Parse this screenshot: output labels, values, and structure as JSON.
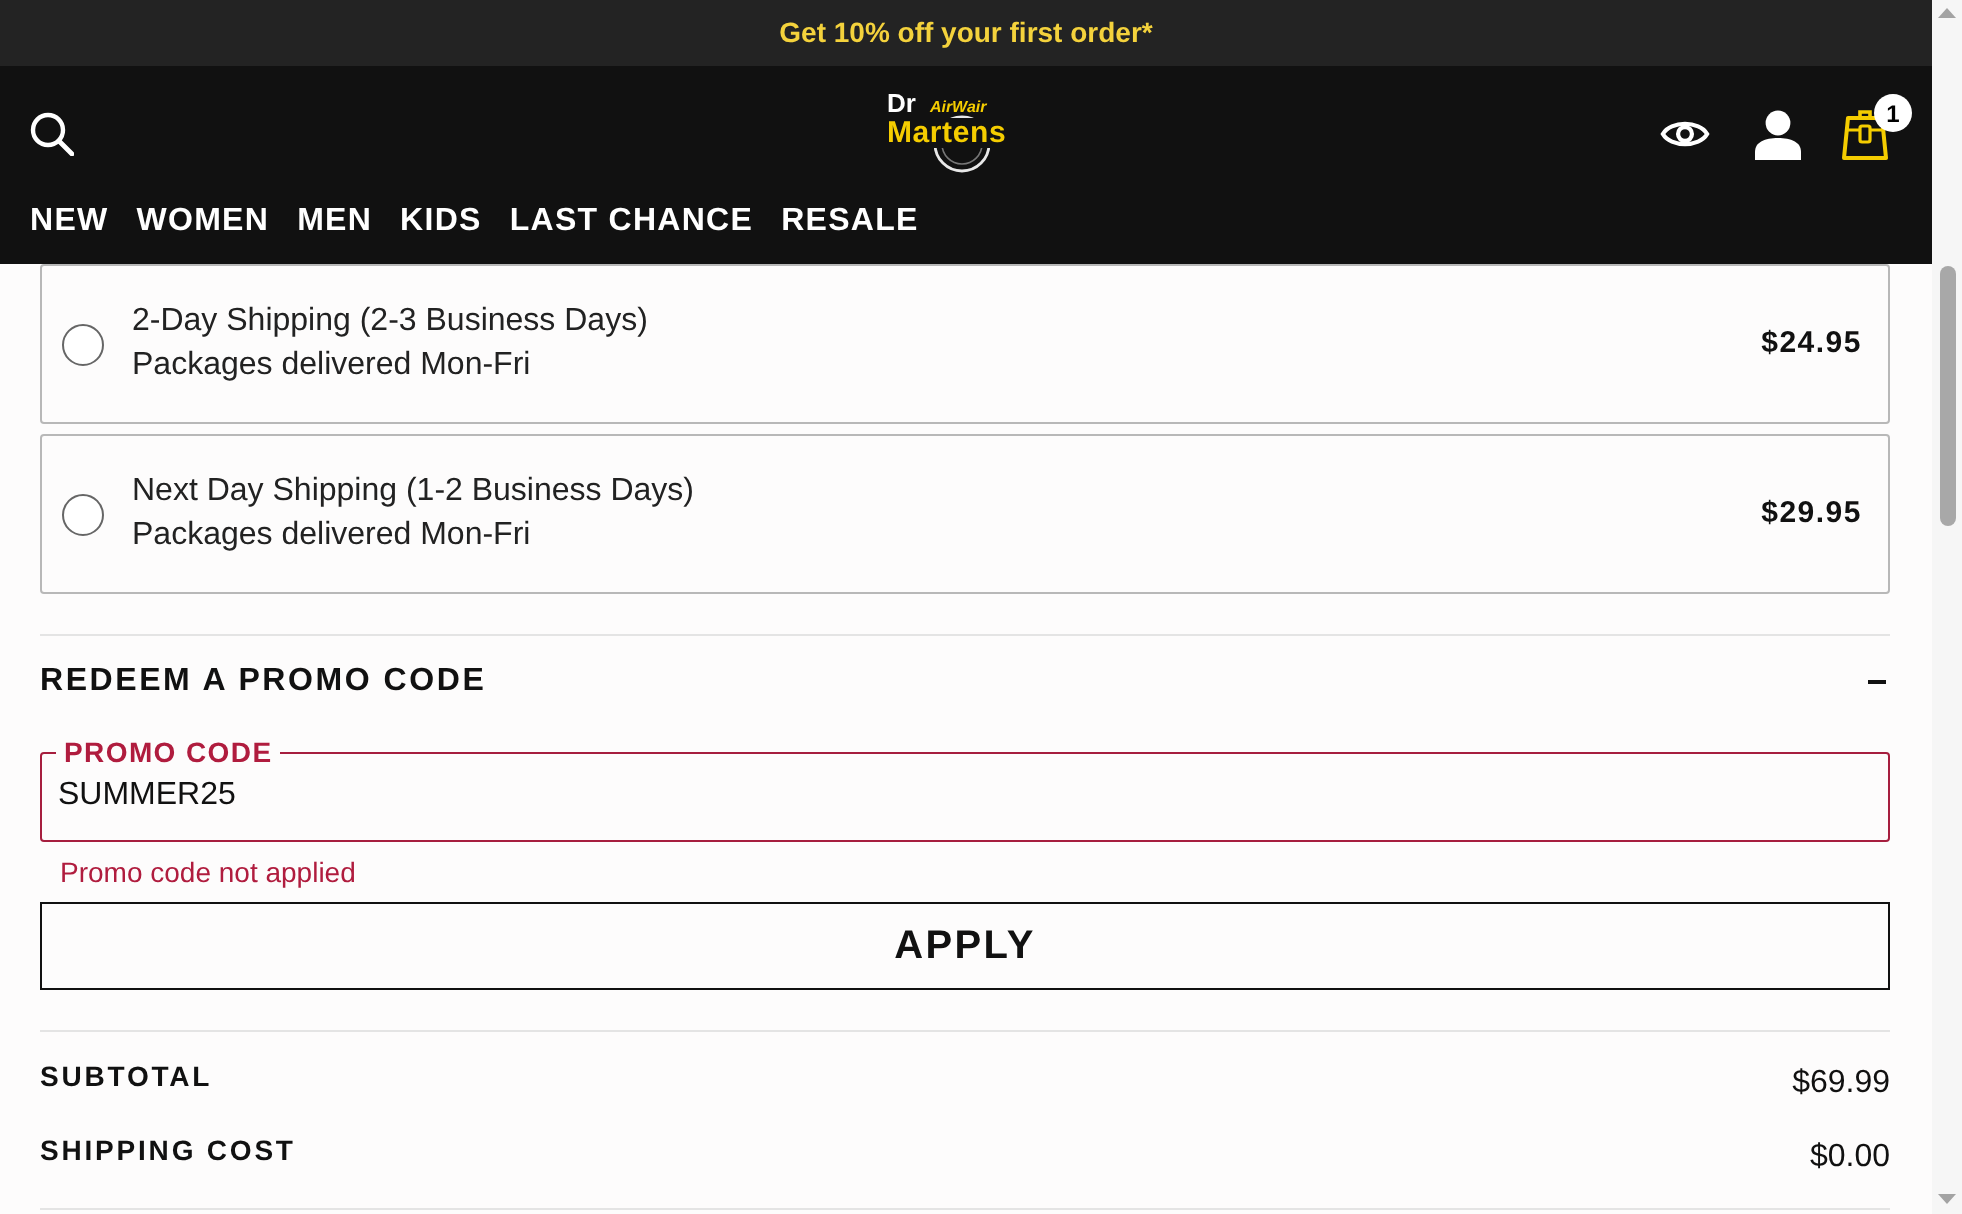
{
  "banner": {
    "text": "Get 10% off your first order*"
  },
  "header": {
    "logo": {
      "line_1": "Dr",
      "tag": "AirWair",
      "line_2": "Martens"
    },
    "cart_count": "1"
  },
  "nav": [
    {
      "label": "NEW"
    },
    {
      "label": "WOMEN"
    },
    {
      "label": "MEN"
    },
    {
      "label": "KIDS"
    },
    {
      "label": "LAST CHANCE"
    },
    {
      "label": "RESALE"
    }
  ],
  "shipping_options": [
    {
      "name": "2-Day Shipping (2-3 Business Days)",
      "detail": "Packages delivered Mon-Fri",
      "price": "$24.95",
      "selected": false
    },
    {
      "name": "Next Day Shipping (1-2 Business Days)",
      "detail": "Packages delivered Mon-Fri",
      "price": "$29.95",
      "selected": false
    }
  ],
  "promo": {
    "title": "REDEEM A PROMO CODE",
    "expanded": true,
    "field": {
      "label": "PROMO CODE",
      "value": "SUMMER25",
      "error": true
    },
    "message": "Promo code not applied",
    "button": "APPLY"
  },
  "summary": [
    {
      "label": "SUBTOTAL",
      "value": "$69.99"
    },
    {
      "label": "SHIPPING COST",
      "value": "$0.00"
    }
  ]
}
